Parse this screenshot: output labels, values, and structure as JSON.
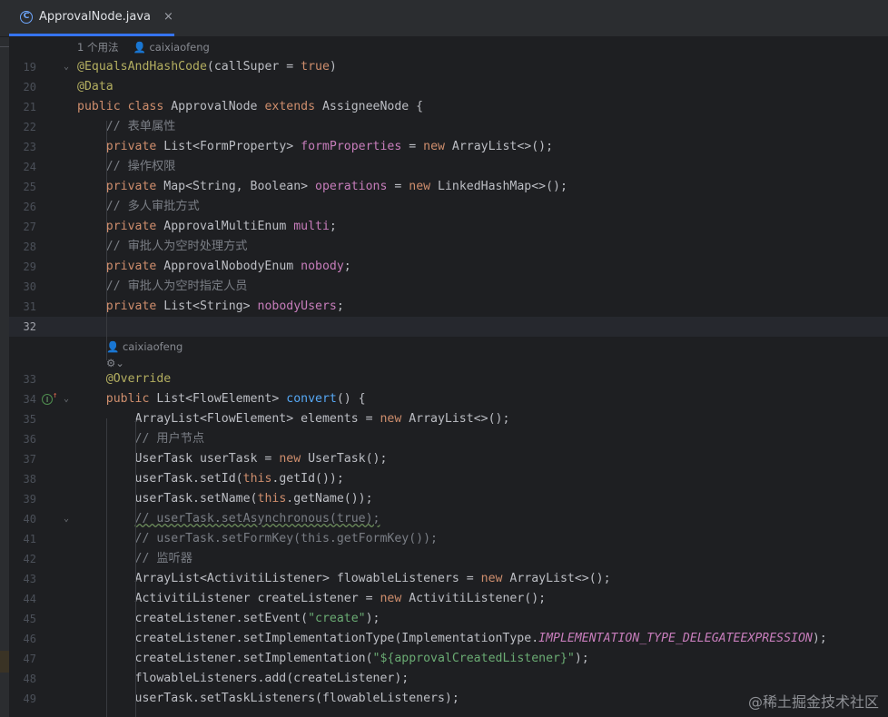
{
  "tab": {
    "icon": "java-class-icon",
    "letter": "C",
    "title": "ApprovalNode.java",
    "close": "×"
  },
  "hints": {
    "class_usage": "1 个用法",
    "class_author": "caixiaofeng",
    "method_author": "caixiaofeng",
    "method_icon": "⚙⌄"
  },
  "lines": [
    {
      "n": "19",
      "fold": "⌄",
      "segs": [
        [
          "an",
          "@EqualsAndHashCode"
        ],
        [
          "",
          "(callSuper = "
        ],
        [
          "kw",
          "true"
        ],
        [
          "",
          ")"
        ]
      ]
    },
    {
      "n": "20",
      "segs": [
        [
          "an",
          "@Data"
        ]
      ]
    },
    {
      "n": "21",
      "segs": [
        [
          "kw",
          "public class "
        ],
        [
          "",
          "ApprovalNode "
        ],
        [
          "kw",
          "extends "
        ],
        [
          "",
          "AssigneeNode {"
        ]
      ]
    },
    {
      "n": "22",
      "segs": [
        [
          "cm",
          "    // 表单属性"
        ]
      ]
    },
    {
      "n": "23",
      "segs": [
        [
          "kw",
          "    private "
        ],
        [
          "",
          "List<FormProperty> "
        ],
        [
          "fd",
          "formProperties"
        ],
        [
          "",
          " = "
        ],
        [
          "kw",
          "new "
        ],
        [
          "",
          "ArrayList<>();"
        ]
      ]
    },
    {
      "n": "24",
      "segs": [
        [
          "cm",
          "    // 操作权限"
        ]
      ]
    },
    {
      "n": "25",
      "segs": [
        [
          "kw",
          "    private "
        ],
        [
          "",
          "Map<String, Boolean> "
        ],
        [
          "fd",
          "operations"
        ],
        [
          "",
          " = "
        ],
        [
          "kw",
          "new "
        ],
        [
          "",
          "LinkedHashMap<>();"
        ]
      ]
    },
    {
      "n": "26",
      "segs": [
        [
          "cm",
          "    // 多人审批方式"
        ]
      ]
    },
    {
      "n": "27",
      "segs": [
        [
          "kw",
          "    private "
        ],
        [
          "",
          "ApprovalMultiEnum "
        ],
        [
          "fd",
          "multi"
        ],
        [
          "",
          ";"
        ]
      ]
    },
    {
      "n": "28",
      "segs": [
        [
          "cm",
          "    // 审批人为空时处理方式"
        ]
      ]
    },
    {
      "n": "29",
      "segs": [
        [
          "kw",
          "    private "
        ],
        [
          "",
          "ApprovalNobodyEnum "
        ],
        [
          "fd",
          "nobody"
        ],
        [
          "",
          ";"
        ]
      ]
    },
    {
      "n": "30",
      "segs": [
        [
          "cm",
          "    // 审批人为空时指定人员"
        ]
      ]
    },
    {
      "n": "31",
      "segs": [
        [
          "kw",
          "    private "
        ],
        [
          "",
          "List<String> "
        ],
        [
          "fd",
          "nobodyUsers"
        ],
        [
          "",
          ";"
        ]
      ]
    },
    {
      "n": "32",
      "active": true,
      "segs": []
    },
    {
      "n": "33",
      "segs": [
        [
          "an",
          "    @Override"
        ]
      ]
    },
    {
      "n": "34",
      "fold": "⌄",
      "override": true,
      "segs": [
        [
          "kw",
          "    public "
        ],
        [
          "",
          "List<FlowElement> "
        ],
        [
          "fn",
          "convert"
        ],
        [
          "",
          "() {"
        ]
      ]
    },
    {
      "n": "35",
      "segs": [
        [
          "",
          "        ArrayList<FlowElement> elements = "
        ],
        [
          "kw",
          "new "
        ],
        [
          "",
          "ArrayList<>();"
        ]
      ]
    },
    {
      "n": "36",
      "segs": [
        [
          "cm",
          "        // 用户节点"
        ]
      ]
    },
    {
      "n": "37",
      "segs": [
        [
          "",
          "        UserTask userTask = "
        ],
        [
          "kw",
          "new "
        ],
        [
          "",
          "UserTask();"
        ]
      ]
    },
    {
      "n": "38",
      "segs": [
        [
          "",
          "        userTask.setId("
        ],
        [
          "kw",
          "this"
        ],
        [
          "",
          ".getId());"
        ]
      ]
    },
    {
      "n": "39",
      "segs": [
        [
          "",
          "        userTask.setName("
        ],
        [
          "kw",
          "this"
        ],
        [
          "",
          ".getName());"
        ]
      ]
    },
    {
      "n": "40",
      "fold": "⌄",
      "segs": [
        [
          "cm",
          "        "
        ],
        [
          "cm typo",
          "// userTask.setAsynchronous(true);"
        ]
      ]
    },
    {
      "n": "41",
      "segs": [
        [
          "cm",
          "        // userTask.setFormKey(this.getFormKey());"
        ]
      ]
    },
    {
      "n": "42",
      "segs": [
        [
          "cm",
          "        // 监听器"
        ]
      ]
    },
    {
      "n": "43",
      "segs": [
        [
          "",
          "        ArrayList<ActivitiListener> flowableListeners = "
        ],
        [
          "kw",
          "new "
        ],
        [
          "",
          "ArrayList<>();"
        ]
      ]
    },
    {
      "n": "44",
      "segs": [
        [
          "",
          "        ActivitiListener createListener = "
        ],
        [
          "kw",
          "new "
        ],
        [
          "",
          "ActivitiListener();"
        ]
      ]
    },
    {
      "n": "45",
      "segs": [
        [
          "",
          "        createListener.setEvent("
        ],
        [
          "st",
          "\"create\""
        ],
        [
          "",
          ");"
        ]
      ]
    },
    {
      "n": "46",
      "segs": [
        [
          "",
          "        createListener.setImplementationType(ImplementationType."
        ],
        [
          "cs",
          "IMPLEMENTATION_TYPE_DELEGATEEXPRESSION"
        ],
        [
          "",
          ");"
        ]
      ]
    },
    {
      "n": "47",
      "segs": [
        [
          "",
          "        createListener.setImplementation("
        ],
        [
          "st",
          "\"${approvalCreatedListener}\""
        ],
        [
          "",
          ");"
        ]
      ]
    },
    {
      "n": "48",
      "segs": [
        [
          "",
          "        flowableListeners.add(createListener);"
        ]
      ]
    },
    {
      "n": "49",
      "segs": [
        [
          "",
          "        userTask.setTaskListeners(flowableListeners);"
        ]
      ]
    }
  ],
  "watermark": "@稀土掘金技术社区"
}
